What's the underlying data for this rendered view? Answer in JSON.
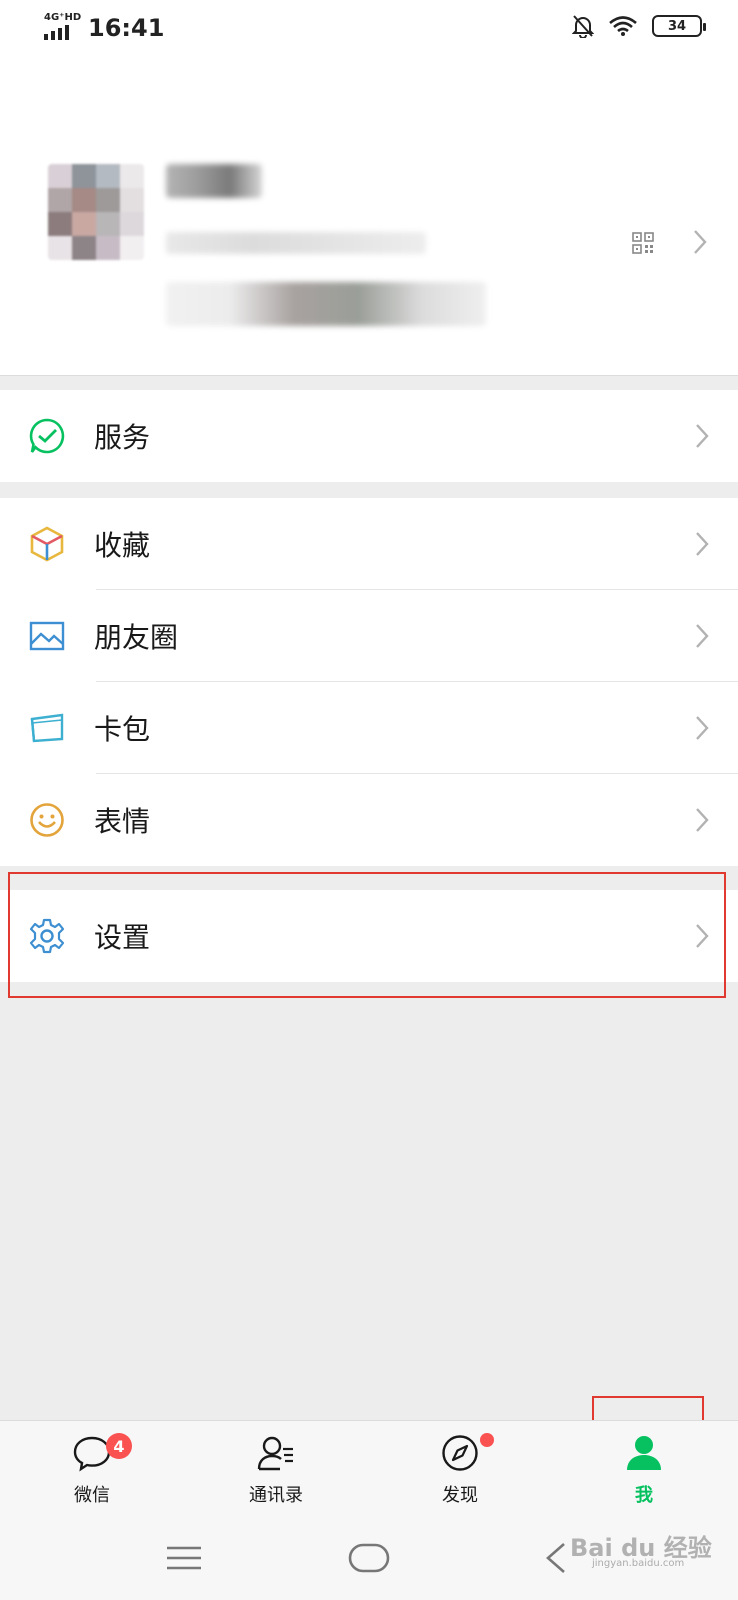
{
  "status_bar": {
    "network": "4G⁺HD",
    "time": "16:41",
    "battery": "34"
  },
  "menu": {
    "services": "服务",
    "favorites": "收藏",
    "moments": "朋友圈",
    "cards": "卡包",
    "stickers": "表情",
    "settings": "设置"
  },
  "tabs": [
    {
      "label": "微信",
      "badge": "4",
      "icon": "chat-icon"
    },
    {
      "label": "通讯录",
      "icon": "contacts-icon"
    },
    {
      "label": "发现",
      "icon": "compass-icon"
    },
    {
      "label": "我",
      "icon": "me-icon",
      "active": true
    }
  ],
  "watermark": {
    "brand": "Bai du 经验",
    "url": "jingyan.baidu.com"
  },
  "colors": {
    "accent_green": "#07c160",
    "badge_red": "#fa5151",
    "highlight_red": "#e0392f",
    "icon_blue": "#3d8fd1"
  }
}
